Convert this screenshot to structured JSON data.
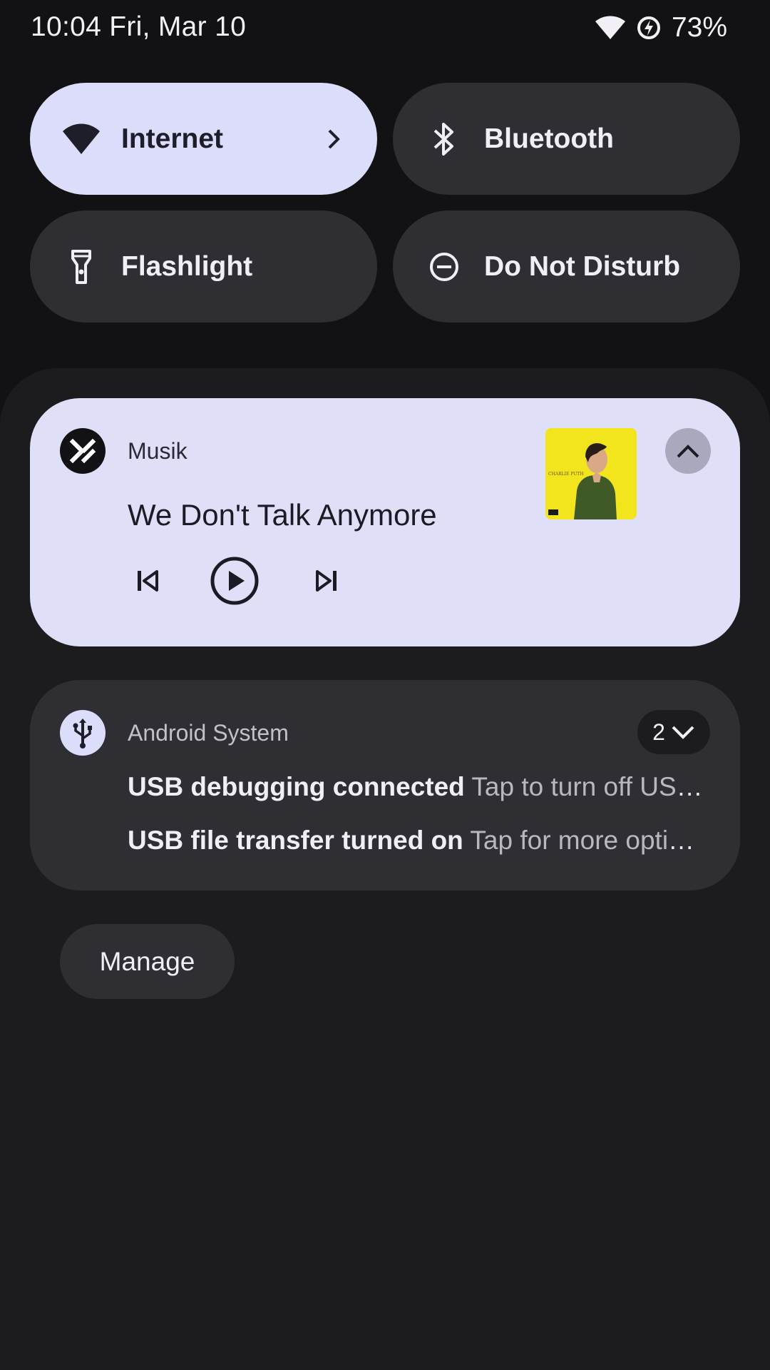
{
  "status_bar": {
    "clock": "10:04 Fri, Mar 10",
    "battery": "73%",
    "icons": [
      "wifi-icon",
      "battery-saver-icon"
    ]
  },
  "quick_settings": {
    "tiles": [
      {
        "label": "Internet",
        "icon": "wifi-icon",
        "active": true,
        "has_chevron": true
      },
      {
        "label": "Bluetooth",
        "icon": "bluetooth-icon",
        "active": false
      },
      {
        "label": "Flashlight",
        "icon": "flashlight-icon",
        "active": false
      },
      {
        "label": "Do Not Disturb",
        "icon": "do-not-disturb-icon",
        "active": false
      }
    ]
  },
  "media": {
    "app_name": "Musik",
    "title": "We Don't Talk Anymore",
    "controls": [
      "previous-icon",
      "play-icon",
      "next-icon"
    ],
    "expand_icon": "chevron-up-icon",
    "album_art_text": "CHARLIE PUTH"
  },
  "system_notification": {
    "app_name": "Android System",
    "count": "2",
    "lines": [
      {
        "title": "USB debugging connected",
        "body": "Tap to turn off USB debugging"
      },
      {
        "title": "USB file transfer turned on",
        "body": "Tap for more options."
      }
    ]
  },
  "manage": {
    "label": "Manage"
  },
  "colors": {
    "background": "#121214",
    "shade": "#1c1c1f",
    "tile_inactive": "#2f2f33",
    "tile_active": "#dcdcfb",
    "media_card": "#dfe0f8"
  }
}
